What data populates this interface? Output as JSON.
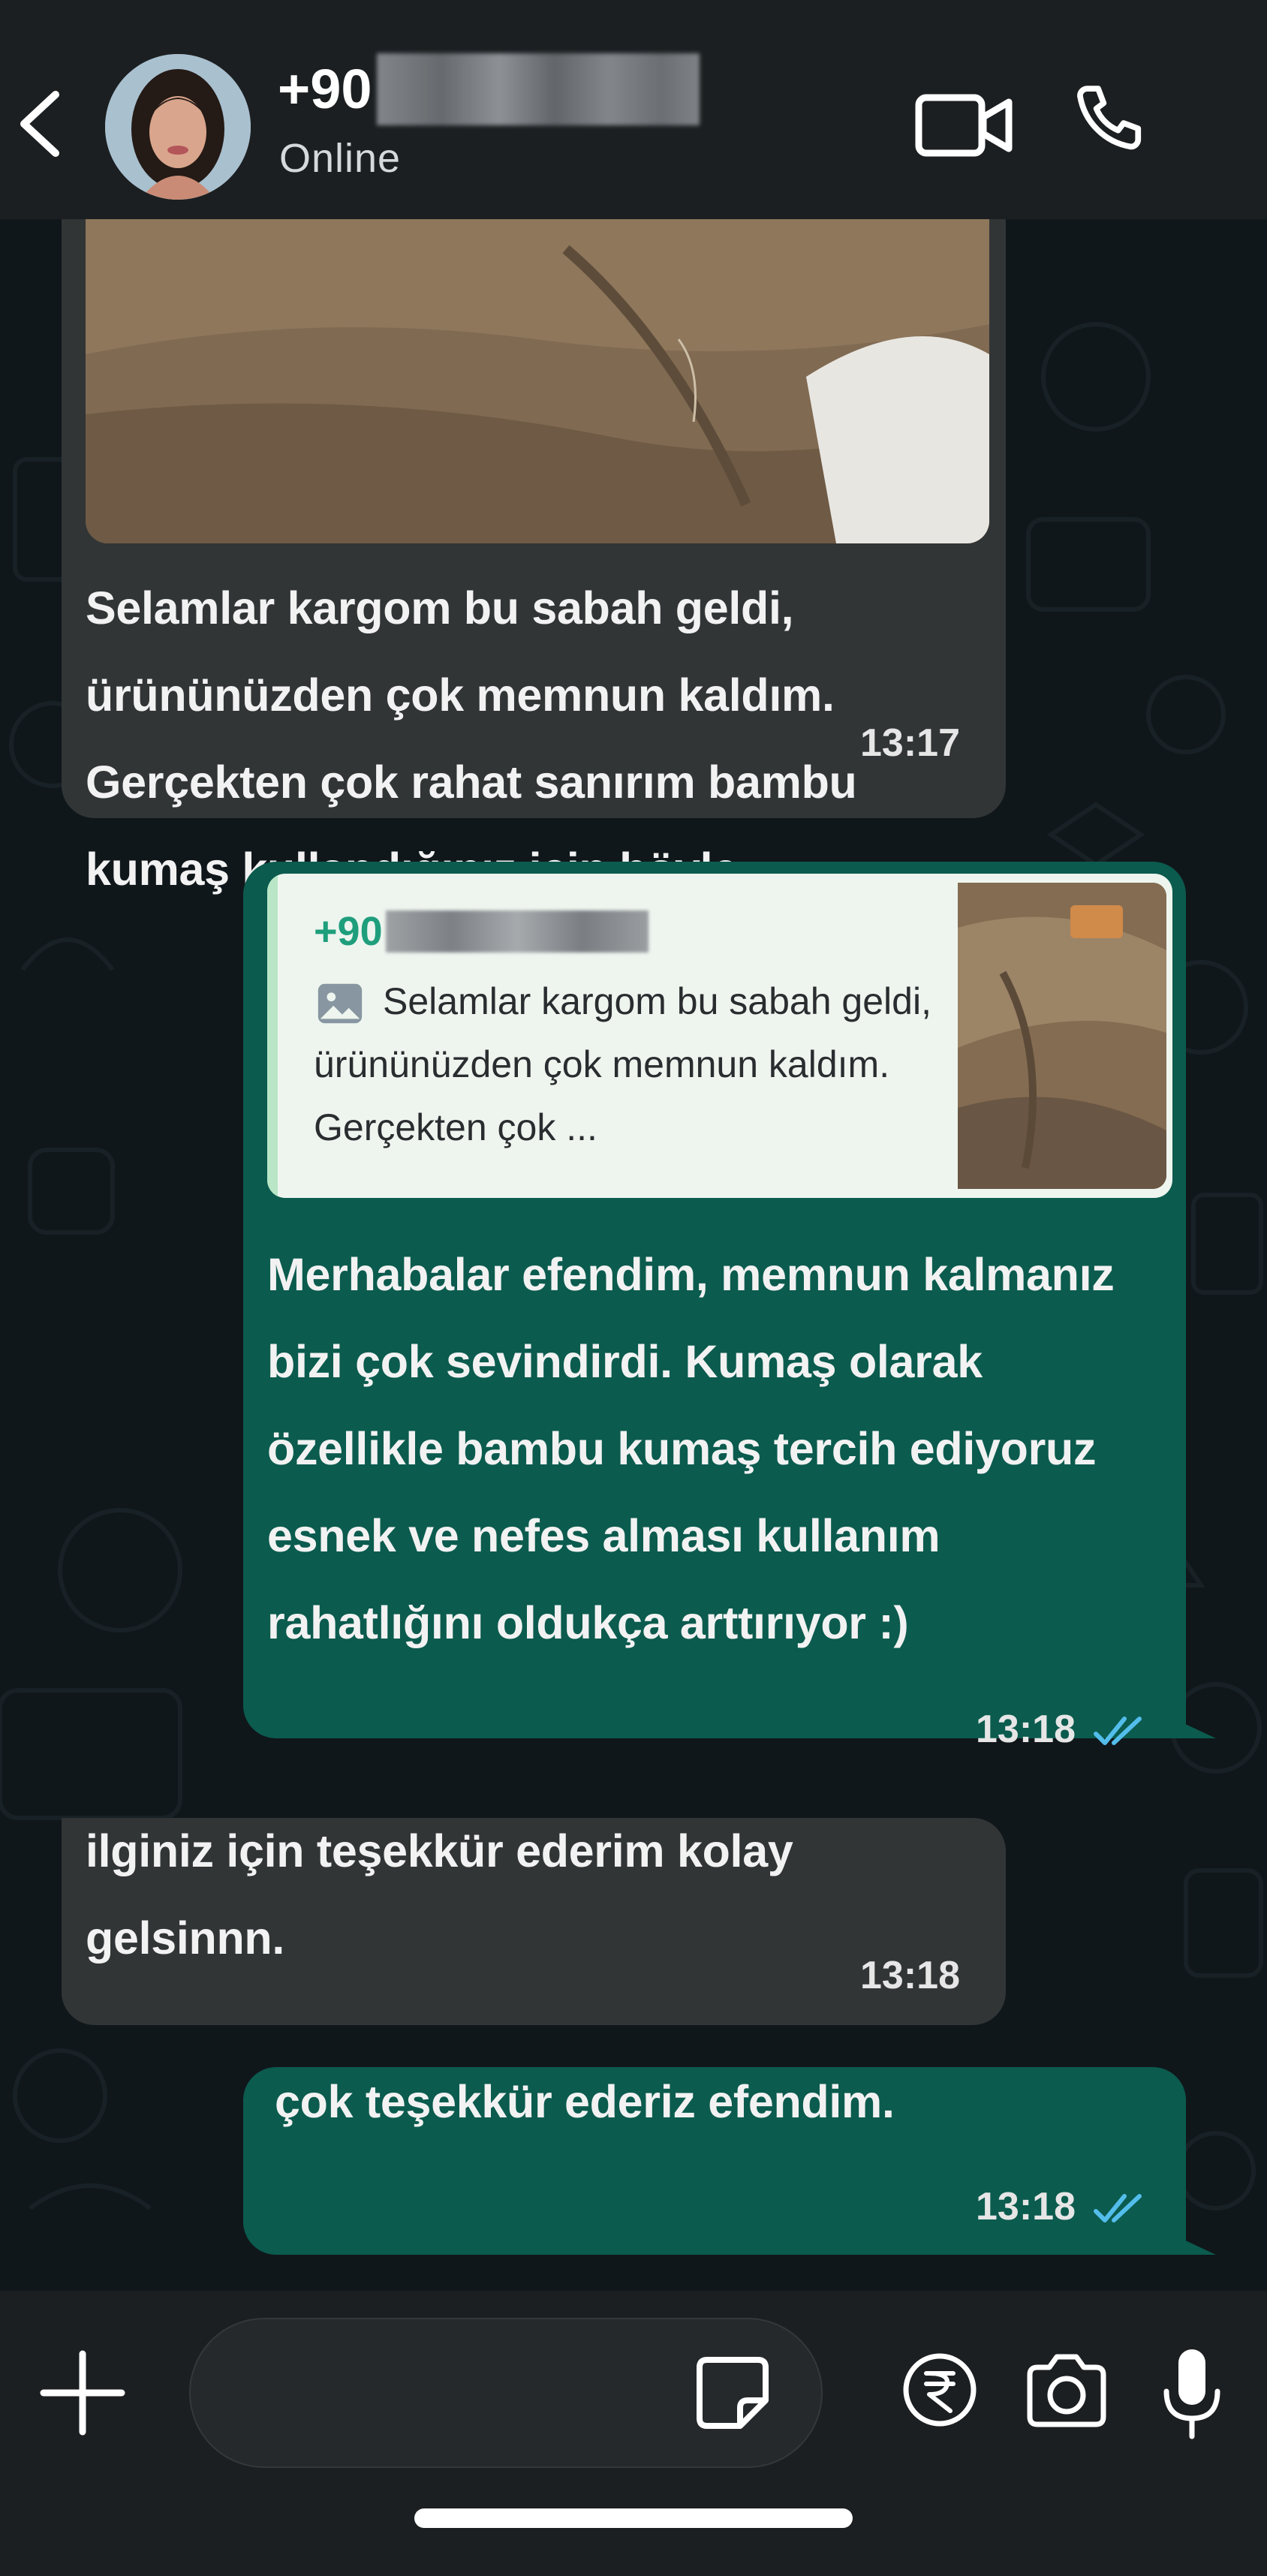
{
  "header": {
    "contact_number_prefix": "+90",
    "status": "Online",
    "back_icon": "chevron-left-icon",
    "video_icon": "video-camera-icon",
    "call_icon": "phone-icon"
  },
  "messages": [
    {
      "direction": "incoming",
      "has_photo": true,
      "text": "Selamlar kargom bu sabah geldi, ürününüzden çok memnun kaldım. Gerçekten çok rahat sanırım bambu kumaş kullandığınız için böyle.",
      "time": "13:17"
    },
    {
      "direction": "outgoing",
      "quoted": {
        "author_prefix": "+90",
        "text": "Selamlar kargom bu sabah geldi, ürününüzden çok memnun kaldım. Gerçekten çok ..."
      },
      "text": "Merhabalar efendim, memnun kalmanız bizi çok sevindirdi. Kumaş olarak özellikle bambu kumaş tercih ediyoruz esnek ve nefes alması kullanım rahatlığını oldukça arttırıyor :)",
      "time": "13:18",
      "read": true
    },
    {
      "direction": "incoming",
      "text": "ilginiz için teşekkür ederim kolay gelsinnn.",
      "time": "13:18"
    },
    {
      "direction": "outgoing",
      "text": "çok teşekkür ederiz efendim.",
      "time": "13:18",
      "read": true
    }
  ],
  "composer": {
    "input_value": "",
    "icons": [
      "plus-icon",
      "sticker-icon",
      "rupee-payment-icon",
      "camera-icon",
      "microphone-icon"
    ]
  },
  "colors": {
    "header_bg": "#1c1f21",
    "chat_bg": "#10171b",
    "incoming_bubble": "#323536",
    "outgoing_bubble": "#0b5b4e",
    "quote_author": "#1f9e7c",
    "read_ticks": "#53bdeb"
  }
}
